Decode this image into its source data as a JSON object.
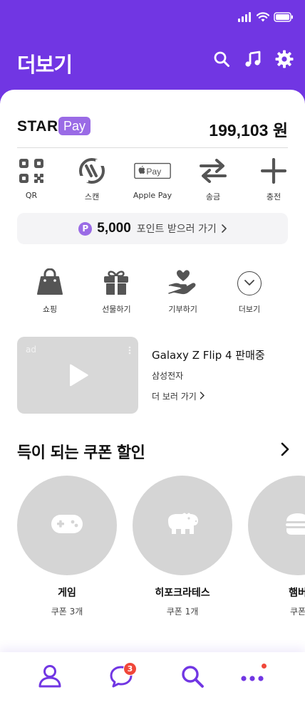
{
  "header": {
    "title": "더보기",
    "icons": [
      "search-icon",
      "music-icon",
      "gear-icon"
    ]
  },
  "pay": {
    "brand_text": "STAR",
    "brand_badge": "Pay",
    "balance": "199,103 원",
    "actions": [
      {
        "label": "QR",
        "icon": "qr-icon"
      },
      {
        "label": "스캔",
        "icon": "scan-icon"
      },
      {
        "label": "Apple Pay",
        "icon": "apple-pay-icon"
      },
      {
        "label": "송금",
        "icon": "transfer-icon"
      },
      {
        "label": "충전",
        "icon": "plus-icon"
      }
    ],
    "points": {
      "coin": "P",
      "amount": "5,000",
      "text": "포인트 받으러 가기"
    }
  },
  "services": [
    {
      "label": "쇼핑",
      "icon": "shopping-bag-icon"
    },
    {
      "label": "선물하기",
      "icon": "gift-icon"
    },
    {
      "label": "기부하기",
      "icon": "donate-heart-icon"
    },
    {
      "label": "더보기",
      "icon": "chevron-down-icon"
    }
  ],
  "ad": {
    "tag": "ad",
    "title": "Galaxy Z Flip 4 판매중",
    "brand": "삼성전자",
    "link": "더 보러 가기"
  },
  "coupons": {
    "title": "득이 되는 쿠폰 할인",
    "items": [
      {
        "name": "게임",
        "count": "쿠폰 3개",
        "icon": "gamepad-icon"
      },
      {
        "name": "히포크라테스",
        "count": "쿠폰 1개",
        "icon": "hippo-icon"
      },
      {
        "name": "햄버",
        "count": "쿠폰",
        "icon": "burger-icon"
      }
    ]
  },
  "nav": {
    "chat_badge": "3",
    "items": [
      "profile-icon",
      "chat-icon",
      "search-icon",
      "more-icon"
    ]
  },
  "colors": {
    "brand": "#7136e3",
    "badge_purple": "#9a6be6",
    "alert_red": "#f0473a",
    "placeholder_gray": "#d5d5d5"
  }
}
